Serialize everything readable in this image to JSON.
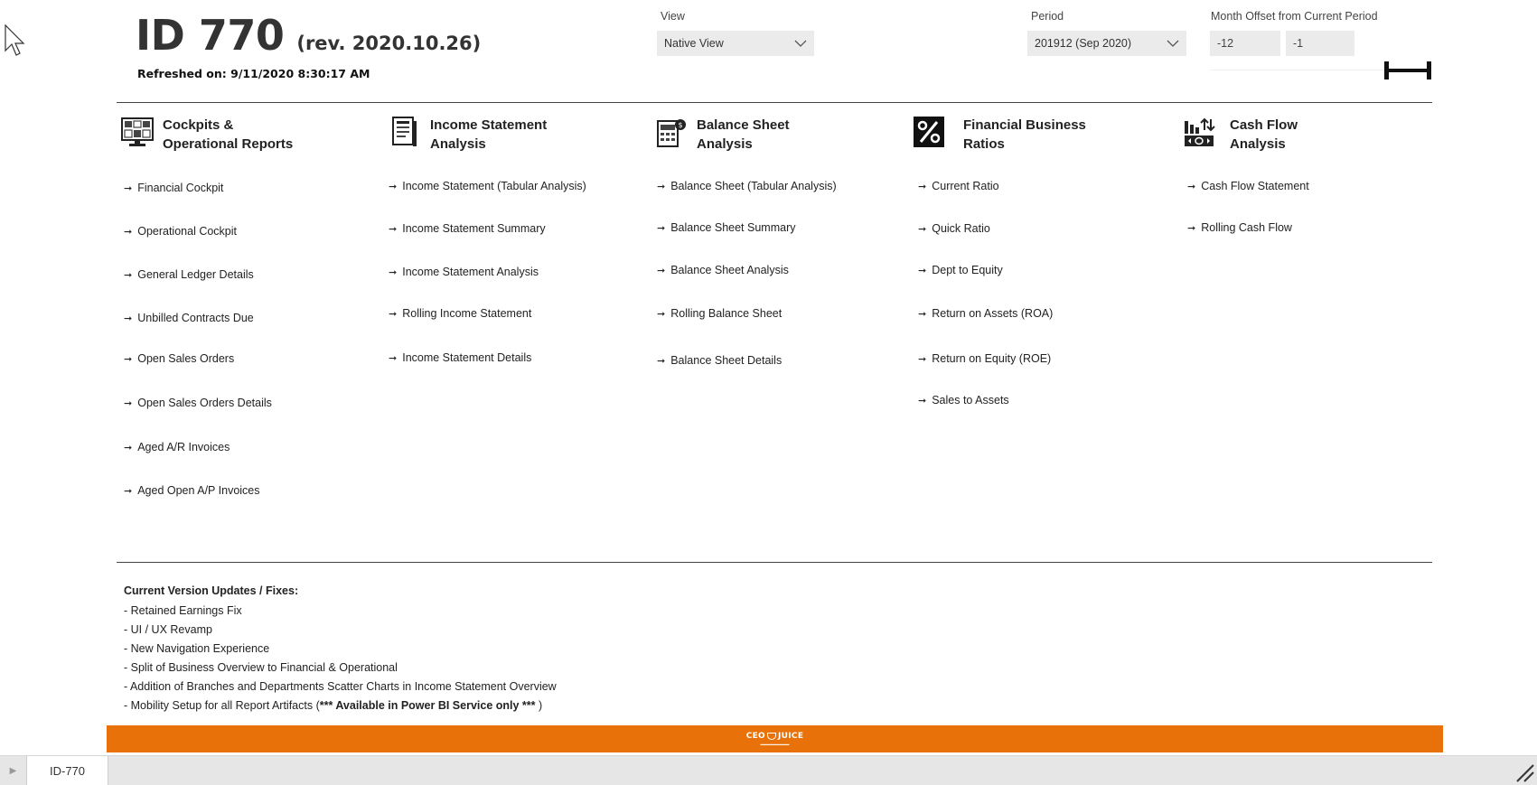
{
  "header": {
    "title": "ID 770",
    "revision": "(rev. 2020.10.26)",
    "refreshed": "Refreshed on: 9/11/2020 8:30:17 AM"
  },
  "filters": {
    "view": {
      "label": "View",
      "value": "Native View"
    },
    "period": {
      "label": "Period",
      "value": "201912 (Sep 2020)"
    },
    "month_offset": {
      "label": "Month Offset from Current Period",
      "min": "-12",
      "max": "-1"
    }
  },
  "sections": [
    {
      "title": "Cockpits &\nOperational Reports",
      "icon": "dashboard-icon",
      "links": [
        "Financial Cockpit",
        "Operational Cockpit",
        "General Ledger Details",
        "Unbilled Contracts Due",
        "Open Sales Orders",
        "Open Sales Orders Details",
        "Aged A/R Invoices",
        "Aged Open A/P Invoices"
      ]
    },
    {
      "title": "Income Statement\nAnalysis",
      "icon": "document-icon",
      "links": [
        "Income Statement (Tabular Analysis)",
        "Income Statement Summary",
        "Income Statement Analysis",
        "Rolling Income Statement",
        "Income Statement Details"
      ]
    },
    {
      "title": "Balance Sheet\nAnalysis",
      "icon": "balance-sheet-icon",
      "links": [
        "Balance Sheet (Tabular Analysis)",
        "Balance Sheet Summary",
        "Balance Sheet Analysis",
        "Rolling Balance Sheet",
        "Balance Sheet Details"
      ]
    },
    {
      "title": "Financial Business\nRatios",
      "icon": "percent-icon",
      "links": [
        "Current Ratio",
        "Quick Ratio",
        "Dept to Equity",
        "Return on Assets (ROA)",
        "Return on Equity (ROE)",
        "Sales to Assets"
      ]
    },
    {
      "title": "Cash Flow\nAnalysis",
      "icon": "cash-flow-icon",
      "links": [
        "Cash Flow Statement",
        "Rolling Cash Flow"
      ]
    }
  ],
  "updates": {
    "title": "Current Version Updates / Fixes:",
    "items": [
      "- Retained Earnings Fix",
      "- UI / UX Revamp",
      "- New Navigation Experience",
      "- Split of Business Overview to Financial & Operational",
      "- Addition of Branches and Departments Scatter Charts in Income Statement Overview"
    ],
    "last_item_prefix": "- Mobility Setup for all Report Artifacts (",
    "last_item_bold": "***  Available in Power BI Service only ***",
    "last_item_suffix": " )"
  },
  "footer": {
    "logo_left": "CEO",
    "logo_right": "JUICE",
    "accent": "#e8710a"
  },
  "tabs": [
    {
      "label": "ID-770"
    }
  ]
}
